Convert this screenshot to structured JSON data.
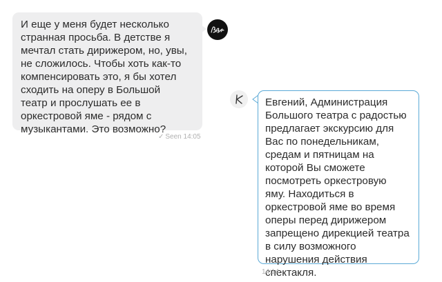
{
  "incoming_message": {
    "lines": [
      "И еще у меня будет несколько",
      "странная просьба. В детстве я",
      "мечтал стать дирижером, но, увы,",
      "не сложилось. Чтобы хоть как-то",
      "компенсировать это, я бы хотел",
      "сходить на оперу в Большой",
      "театр и прослушать ее в",
      "оркестровой яме - рядом с",
      "музыкантами. Это возможно?"
    ],
    "status_icon": "check-icon",
    "status_text": "Seen 14:05"
  },
  "outgoing_message": {
    "lines": [
      "Евгений,  Администрация",
      "Большого театра с радостью",
      "предлагает экскурсию для",
      "Вас по понедельникам,",
      "средам и пятницам на",
      "которой Вы сможете",
      "посмотреть оркестровую",
      "яму. Находиться в",
      "оркестровой яме во время",
      "оперы перед дирижером",
      "запрещено дирекцией театра",
      "в силу возможного",
      "нарушения действия",
      "спектакля."
    ],
    "time": "14:14"
  },
  "colors": {
    "incoming_bubble": "#eeeeef",
    "outgoing_border": "#5aa9d6",
    "meta_text": "#b0b0b0"
  }
}
